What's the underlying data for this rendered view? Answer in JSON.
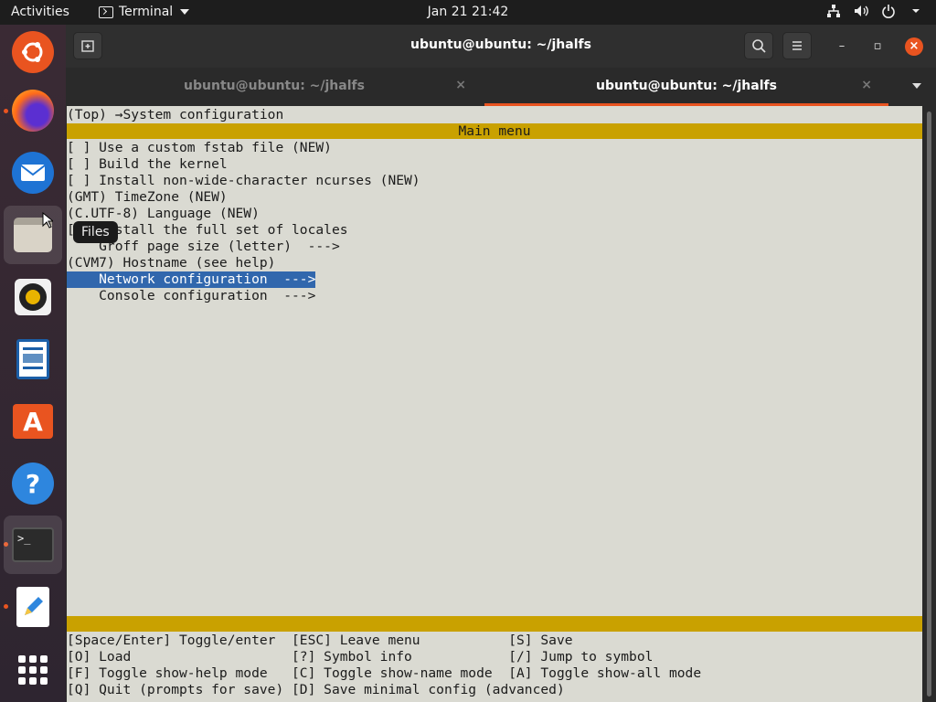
{
  "topbar": {
    "activities": "Activities",
    "app_name": "Terminal",
    "clock": "Jan 21  21:42",
    "icons": [
      "network-icon",
      "volume-icon",
      "power-icon",
      "chevron-down-icon"
    ]
  },
  "dock": {
    "items": [
      {
        "name": "ubuntu-icon"
      },
      {
        "name": "firefox-icon"
      },
      {
        "name": "thunderbird-icon"
      },
      {
        "name": "files-icon"
      },
      {
        "name": "rhythmbox-icon"
      },
      {
        "name": "libreoffice-writer-icon"
      },
      {
        "name": "ubuntu-software-icon"
      },
      {
        "name": "help-icon"
      },
      {
        "name": "terminal-icon"
      },
      {
        "name": "text-editor-icon"
      },
      {
        "name": "show-apps-icon"
      }
    ],
    "tooltip": "Files"
  },
  "window": {
    "title": "ubuntu@ubuntu: ~/jhalfs",
    "tabs": [
      {
        "label": "ubuntu@ubuntu: ~/jhalfs",
        "active": false
      },
      {
        "label": "ubuntu@ubuntu: ~/jhalfs",
        "active": true
      }
    ]
  },
  "terminal": {
    "breadcrumb": "(Top) →System configuration",
    "menu_title": "Main menu",
    "items": [
      {
        "text": "[ ] Use a custom fstab file (NEW)",
        "selected": false
      },
      {
        "text": "[ ] Build the kernel",
        "selected": false
      },
      {
        "text": "[ ] Install non-wide-character ncurses (NEW)",
        "selected": false
      },
      {
        "text": "(GMT) TimeZone (NEW)",
        "selected": false
      },
      {
        "text": "(C.UTF-8) Language (NEW)",
        "selected": false
      },
      {
        "text": "[ ] Install the full set of locales",
        "selected": false
      },
      {
        "text": "    Groff page size (letter)  --->",
        "selected": false
      },
      {
        "text": "(CVM7) Hostname (see help)",
        "selected": false
      },
      {
        "text": "    Network configuration  --->",
        "selected": true
      },
      {
        "text": "    Console configuration  --->",
        "selected": false
      }
    ],
    "help_lines": [
      "[Space/Enter] Toggle/enter  [ESC] Leave menu           [S] Save",
      "[O] Load                    [?] Symbol info            [/] Jump to symbol",
      "[F] Toggle show-help mode   [C] Toggle show-name mode  [A] Toggle show-all mode",
      "[Q] Quit (prompts for save) [D] Save minimal config (advanced)"
    ]
  }
}
